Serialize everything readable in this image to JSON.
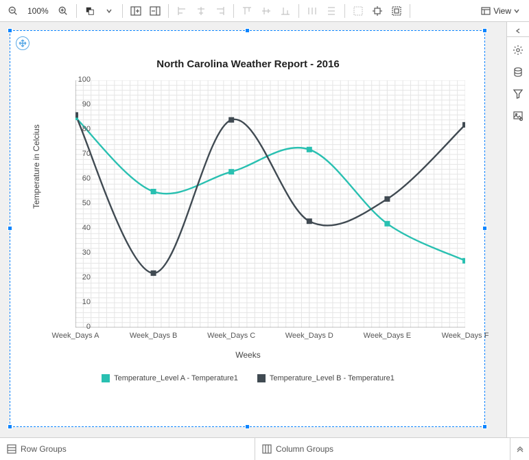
{
  "toolbar": {
    "zoom_level": "100%",
    "view_label": "View"
  },
  "footer": {
    "row_groups": "Row Groups",
    "column_groups": "Column Groups"
  },
  "chart_data": {
    "type": "line",
    "title": "North Carolina Weather Report - 2016",
    "xlabel": "Weeks",
    "ylabel": "Temperature in Celcius",
    "ylim": [
      0,
      100
    ],
    "y_ticks": [
      0,
      10,
      20,
      30,
      40,
      50,
      60,
      70,
      80,
      90,
      100
    ],
    "categories": [
      "Week_Days A",
      "Week_Days B",
      "Week_Days C",
      "Week_Days D",
      "Week_Days E",
      "Week_Days F"
    ],
    "series": [
      {
        "name": "Temperature_Level A - Temperature1",
        "color": "#29c0b1",
        "values": [
          85,
          55,
          63,
          72,
          42,
          27
        ]
      },
      {
        "name": "Temperature_Level B - Temperature1",
        "color": "#404a52",
        "values": [
          86,
          22,
          84,
          43,
          52,
          82
        ]
      }
    ]
  }
}
